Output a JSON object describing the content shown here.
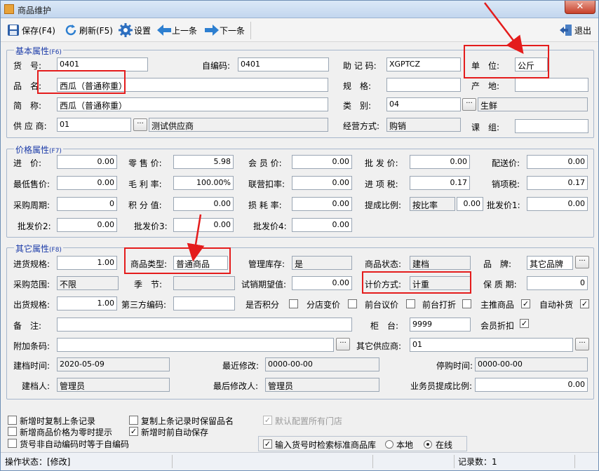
{
  "window": {
    "title": "商品维护",
    "close": "✕"
  },
  "toolbar": {
    "save": "保存(F4)",
    "refresh": "刷新(F5)",
    "settings": "设置",
    "prev": "上一条",
    "next": "下一条",
    "exit": "退出"
  },
  "basic": {
    "title": "基本属性",
    "key": "(F6)",
    "item_no_label": "货　号:",
    "item_no": "0401",
    "self_code_label": "自编码:",
    "self_code": "0401",
    "mnemonic_label": "助 记 码:",
    "mnemonic": "XGPTCZ",
    "unit_label": "单　位:",
    "unit": "公斤",
    "name_label": "品　名:",
    "name": "西瓜（普通称重）",
    "spec_label": "规　格:",
    "spec": "",
    "origin_label": "产　地:",
    "origin": "",
    "short_label": "简　称:",
    "short_name": "西瓜（普通称重）",
    "category_label": "类　别:",
    "category_code": "04",
    "category_name": "生鲜",
    "supplier_label": "供 应 商:",
    "supplier_code": "01",
    "supplier_name": "测试供应商",
    "biz_label": "经营方式:",
    "biz_mode": "购销",
    "team_label": "课　组:",
    "team": ""
  },
  "price": {
    "title": "价格属性",
    "key": "(F7)",
    "fields": [
      {
        "label": "进　价:",
        "value": "0.00"
      },
      {
        "label": "零 售 价:",
        "value": "5.98"
      },
      {
        "label": "会 员 价:",
        "value": "0.00"
      },
      {
        "label": "批 发 价:",
        "value": "0.00"
      },
      {
        "label": "配送价:",
        "value": "0.00"
      },
      {
        "label": "最低售价:",
        "value": "0.00"
      },
      {
        "label": "毛 利 率:",
        "value": "100.00%"
      },
      {
        "label": "联营扣率:",
        "value": "0.00"
      },
      {
        "label": "进 项 税:",
        "value": "0.17"
      },
      {
        "label": "销项税:",
        "value": "0.17"
      },
      {
        "label": "采购周期:",
        "value": "0"
      },
      {
        "label": "积 分 值:",
        "value": "0.00"
      },
      {
        "label": "损 耗 率:",
        "value": "0.00"
      },
      {
        "label": "提成比例:",
        "value": "按比率"
      },
      {
        "label": "",
        "value": "0.00"
      },
      {
        "label": "批发价1:",
        "value": "0.00"
      },
      {
        "label": "批发价2:",
        "value": "0.00"
      },
      {
        "label": "批发价3:",
        "value": "0.00"
      },
      {
        "label": "批发价4:",
        "value": "0.00"
      }
    ]
  },
  "other": {
    "title": "其它属性",
    "key": "(F8)",
    "purchase_spec_label": "进货规格:",
    "purchase_spec": "1.00",
    "goods_type_label": "商品类型:",
    "goods_type": "普通商品",
    "manage_stock_label": "管理库存:",
    "manage_stock": "是",
    "status_label": "商品状态:",
    "status": "建档",
    "brand_label": "品　牌:",
    "brand": "其它品牌",
    "purchase_range_label": "采购范围:",
    "purchase_range": "不限",
    "season_label": "季　节:",
    "season": "",
    "trial_label": "试销期望值:",
    "trial": "0.00",
    "pricing_label": "计价方式:",
    "pricing": "计重",
    "shelf_label": "保 质 期:",
    "shelf": "0",
    "ship_spec_label": "出货规格:",
    "ship_spec": "1.00",
    "third_code_label": "第三方编码:",
    "third_code": "",
    "checks": [
      {
        "label": "是否积分",
        "checked": false
      },
      {
        "label": "分店变价",
        "checked": false
      },
      {
        "label": "前台议价",
        "checked": false
      },
      {
        "label": "前台打折",
        "checked": false
      },
      {
        "label": "主推商品",
        "checked": true
      },
      {
        "label": "自动补货",
        "checked": true
      }
    ],
    "remark_label": "备　注:",
    "remark": "",
    "counter_label": "柜　台:",
    "counter": "9999",
    "member_discount_label": "会员折扣",
    "member_discount": "✓",
    "extra_barcode_label": "附加条码:",
    "extra_barcode": "",
    "other_supplier_label": "其它供应商:",
    "other_supplier": "01",
    "created_label": "建档时间:",
    "created": "2020-05-09",
    "modified_label": "最近修改:",
    "modified": "0000-00-00",
    "stop_label": "停购时间:",
    "stop": "0000-00-00",
    "creator_label": "建档人:",
    "creator": "管理员",
    "modifier_label": "最后修改人:",
    "modifier": "管理员",
    "commission_label": "业务员提成比例:",
    "commission": "0.00"
  },
  "options": {
    "copy_last": "新增时复制上条记录",
    "copy_keep_name": "复制上条记录时保留品名",
    "default_all_stores": "默认配置所有门店",
    "price_zero_warn": "新增商品价格为零时提示",
    "auto_save": "新增时前自动保存",
    "no_auto_code": "货号非自动编码时等于自编码",
    "search_std": "输入货号时检索标准商品库",
    "local": "本地",
    "online": "在线"
  },
  "statusbar": {
    "state": "操作状态：[修改]",
    "records": "记录数：1"
  }
}
